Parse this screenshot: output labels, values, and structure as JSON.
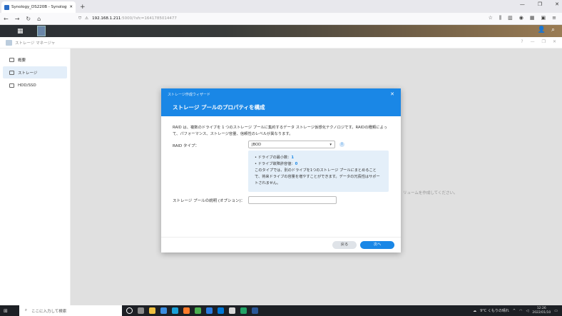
{
  "browser": {
    "tab_title": "Synology_DS220B - Synology",
    "url_host": "192.168.1.211",
    "url_rest": ":5000/?sfc=1641785014477"
  },
  "app": {
    "title": "ストレージ マネージャ",
    "sidebar": [
      {
        "label": "概要",
        "active": false
      },
      {
        "label": "ストレージ",
        "active": true
      },
      {
        "label": "HDD/SSD",
        "active": false
      }
    ],
    "background_text": "リュームを作成してください。"
  },
  "dialog": {
    "wizard_label": "ストレージ作成ウィザード",
    "title": "ストレージ プールのプロパティを構成",
    "description": "RAID は、複数のドライブを 1 つのストレージ プールに集約するデータ ストレージ仮想化テクノロジです。RAIDの種類によって、パフォーマンス、ストレージ容量、信頼性のレベルが異なります。",
    "raid_label": "RAID タイプ：",
    "raid_value": "JBOD",
    "info_min_drives_label": "• ドライブの最小数：",
    "info_min_drives_value": "1",
    "info_fault_label": "• ドライブ故障許容値：",
    "info_fault_value": "0",
    "info_text": "このタイプでは、別のドライブを1つのストレージ プールにまとめることで、将来ドライブの容量を増やすことができます。データの冗長性はサポートされません。",
    "desc_label": "ストレージ プールの説明 (オプション)：",
    "desc_value": "",
    "back_label": "戻る",
    "next_label": "次へ"
  },
  "taskbar": {
    "search_placeholder": "ここに入力して検索",
    "weather": "9°C くもりの晴れ",
    "time": "12:26",
    "date": "2022/01/10",
    "app_colors": [
      "#ffffff",
      "#8a8a8a",
      "#f0c040",
      "#3b8de0",
      "#1aa0d8",
      "#ff7a2a",
      "#4caf50",
      "#2b7be0",
      "#0078d7",
      "#d8d8d8",
      "#21a366",
      "#2b5797"
    ]
  }
}
